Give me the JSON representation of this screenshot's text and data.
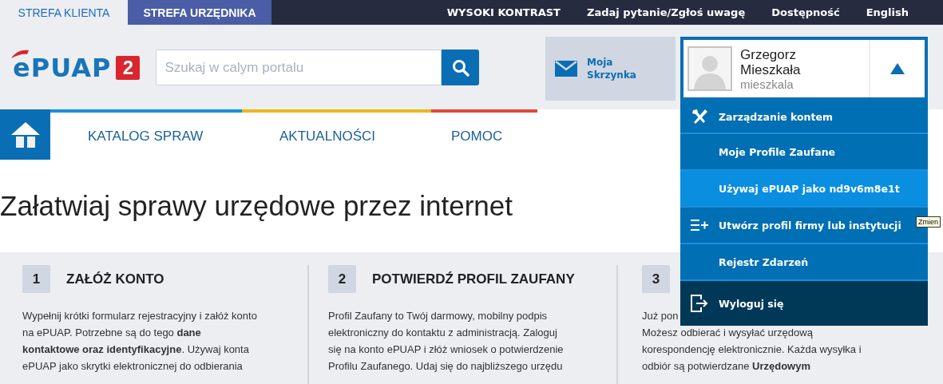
{
  "zone_tabs": [
    {
      "label": "STREFA KLIENTA",
      "selected": true
    },
    {
      "label": "STREFA URZĘDNIKA",
      "selected": false
    }
  ],
  "top_links": [
    "WYSOKI KONTRAST",
    "Zadaj pytanie/Zgłoś uwagę",
    "Dostępność",
    "English"
  ],
  "logo": {
    "text": "ePUAP",
    "badge": "2"
  },
  "search": {
    "placeholder": "Szukaj w calym portalu"
  },
  "mailbox": {
    "label": "Moja Skrzynka"
  },
  "user": {
    "name": "Grzegorz Mieszkała",
    "login": "mieszkala",
    "expanded": true
  },
  "user_menu": [
    {
      "label": "Zarządzanie kontem",
      "kind": "tools",
      "selected": false
    },
    {
      "label": "Moje Profile Zaufane",
      "kind": "plain",
      "selected": false
    },
    {
      "label": "Używaj ePUAP jako nd9v6m8e1t",
      "kind": "plain",
      "selected": true
    },
    {
      "label": "Utwórz profil firmy lub instytucji",
      "kind": "add",
      "selected": false
    },
    {
      "label": "Rejestr Zdarzeń",
      "kind": "plain",
      "selected": false
    },
    {
      "label": "Wyloguj się",
      "kind": "logout",
      "selected": false
    }
  ],
  "tooltip": "Zmien",
  "nav": [
    {
      "label": "KATALOG SPRAW",
      "color": "#1a8fe0"
    },
    {
      "label": "AKTUALNOŚCI",
      "color": "#e8b820"
    },
    {
      "label": "POMOC",
      "color": "#e04a3a"
    }
  ],
  "headline": "Załatwiaj sprawy urzędowe przez internet",
  "steps": [
    {
      "number": "1",
      "title": "ZAŁÓŻ KONTO",
      "lines": [
        "Wypełnij krótki formularz rejestracyjny i załóż konto",
        "na ePUAP. Potrzebne są do tego **dane**",
        "**kontaktowe oraz identyfikacyjne**. Używaj konta",
        "ePUAP jako skrytki elektronicznej do odbierania"
      ]
    },
    {
      "number": "2",
      "title": "POTWIERDŹ PROFIL ZAUFANY",
      "lines": [
        "Profil Zaufany to Twój darmowy, mobilny podpis",
        "elektroniczny do kontaktu z administracją. Zaloguj",
        "się na konto ePUAP i złóż wniosek o potwierdzenie",
        "Profilu Zaufanego. Udaj się do najbliższego urzędu"
      ]
    },
    {
      "number": "3",
      "lines": [
        "Już pon",
        "Możesz odbierać i wysyłać urzędową",
        "korespondencję elektronicznie. Każda wysyłka i",
        "odbiór są potwierdzane **Urzędowym**"
      ]
    }
  ]
}
